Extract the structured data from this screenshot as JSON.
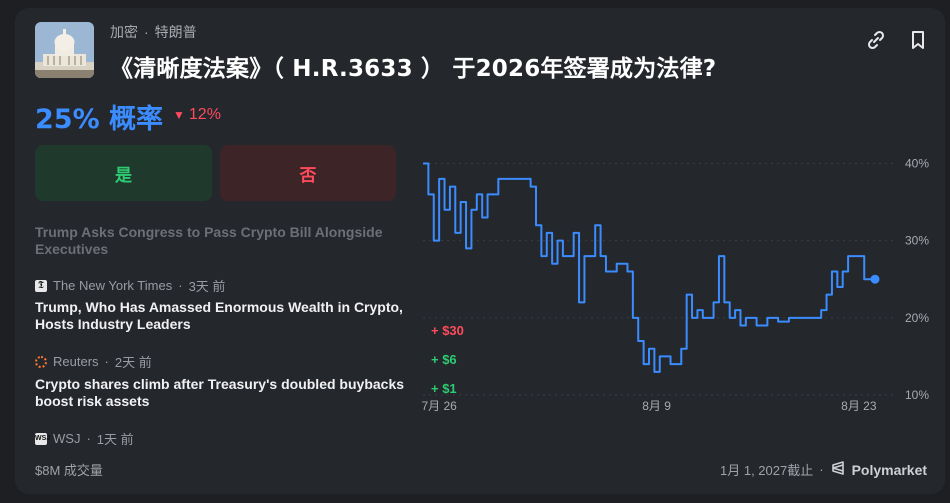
{
  "market": {
    "category": "加密",
    "tag": "特朗普",
    "title": "《清晰度法案》（ H.R.3633 ） 于2026年签署成为法律?",
    "probability_label": "25% 概率",
    "change_label": "12%",
    "change_direction": "down"
  },
  "outcomes": {
    "yes_label": "是",
    "no_label": "否"
  },
  "news": [
    {
      "title": "Trump Asks Congress to Pass Crypto Bill Alongside Executives",
      "source": "The New York Times",
      "age": "3天 前"
    },
    {
      "title": "Trump, Who Has Amassed Enormous Wealth in Crypto, Hosts Industry Leaders",
      "source": "Reuters",
      "age": "2天 前"
    },
    {
      "title": "Crypto shares climb after Treasury's doubled buybacks boost risk assets",
      "source": "WSJ",
      "age": "1天 前"
    }
  ],
  "footer": {
    "volume": "$8M 成交量",
    "deadline": "1月 1, 2027截止",
    "brand": "Polymarket"
  },
  "trades": [
    "+ $30",
    "+ $6",
    "+ $1"
  ],
  "colors": {
    "accent": "#3b8cff",
    "up": "#2ecc71",
    "down": "#ff4b5c"
  },
  "chart_data": {
    "type": "line",
    "x_ticks": [
      "7月 26",
      "8月 9",
      "8月 23"
    ],
    "y_ticks": [
      "40%",
      "30%",
      "20%",
      "10%"
    ],
    "ylim": [
      10,
      42
    ],
    "series": [
      {
        "values": [
          [
            0,
            40
          ],
          [
            0.5,
            36
          ],
          [
            1,
            30
          ],
          [
            1.5,
            38
          ],
          [
            2,
            34
          ],
          [
            2.5,
            37
          ],
          [
            3,
            31
          ],
          [
            3.5,
            35
          ],
          [
            4,
            29
          ],
          [
            4.5,
            34
          ],
          [
            5,
            36
          ],
          [
            5.5,
            33
          ],
          [
            6,
            36
          ],
          [
            7,
            38
          ],
          [
            8,
            38
          ],
          [
            9,
            38
          ],
          [
            10,
            37
          ],
          [
            10.5,
            32
          ],
          [
            11,
            28
          ],
          [
            11.5,
            31
          ],
          [
            12,
            27
          ],
          [
            12.5,
            30
          ],
          [
            13,
            28
          ],
          [
            14,
            31
          ],
          [
            14.5,
            22
          ],
          [
            15,
            28
          ],
          [
            16,
            32
          ],
          [
            16.5,
            28
          ],
          [
            17,
            26
          ],
          [
            18,
            27
          ],
          [
            19,
            26
          ],
          [
            19.5,
            20
          ],
          [
            20,
            17
          ],
          [
            20.5,
            14
          ],
          [
            21,
            16
          ],
          [
            21.5,
            13
          ],
          [
            22,
            15
          ],
          [
            23,
            14
          ],
          [
            24,
            16
          ],
          [
            24.5,
            23
          ],
          [
            25,
            20
          ],
          [
            25.5,
            21
          ],
          [
            26,
            20
          ],
          [
            27,
            22
          ],
          [
            27.5,
            28
          ],
          [
            28,
            22
          ],
          [
            28.5,
            20
          ],
          [
            29,
            21
          ],
          [
            29.5,
            19
          ],
          [
            30,
            20
          ],
          [
            31,
            19
          ],
          [
            32,
            20
          ],
          [
            33,
            19.5
          ],
          [
            34,
            20
          ],
          [
            35,
            20
          ],
          [
            36,
            20
          ],
          [
            37,
            21
          ],
          [
            37.5,
            23
          ],
          [
            38,
            26
          ],
          [
            38.5,
            24
          ],
          [
            39,
            26
          ],
          [
            39.5,
            28
          ],
          [
            40,
            28
          ],
          [
            41,
            25
          ],
          [
            42,
            25
          ]
        ]
      }
    ],
    "xlim": [
      0,
      42
    ]
  }
}
